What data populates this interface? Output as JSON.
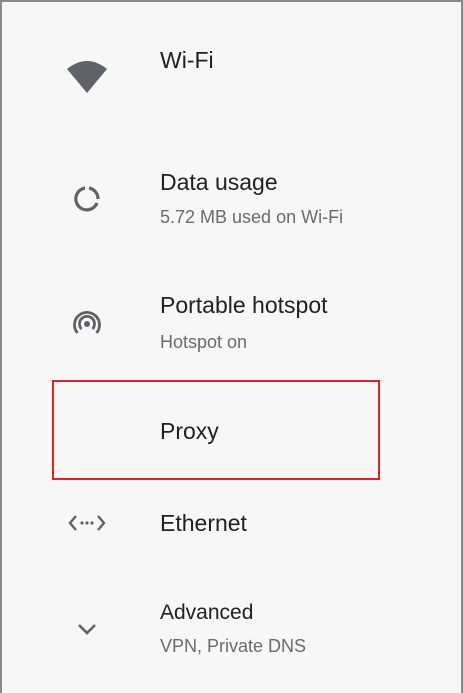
{
  "items": [
    {
      "id": "wifi",
      "title": "Wi-Fi",
      "subtitle": "",
      "icon": "wifi-icon"
    },
    {
      "id": "data-usage",
      "title": "Data usage",
      "subtitle": "5.72 MB used on Wi-Fi",
      "icon": "data-usage-icon"
    },
    {
      "id": "portable-hotspot",
      "title": "Portable hotspot",
      "subtitle": "Hotspot on",
      "icon": "hotspot-icon"
    },
    {
      "id": "proxy",
      "title": "Proxy",
      "subtitle": "",
      "icon": ""
    },
    {
      "id": "ethernet",
      "title": "Ethernet",
      "subtitle": "",
      "icon": "ethernet-icon"
    },
    {
      "id": "advanced",
      "title": "Advanced",
      "subtitle": "VPN, Private DNS",
      "icon": "chevron-down-icon"
    }
  ],
  "colors": {
    "highlight": "#e32020",
    "icon": "#5f6368",
    "title": "#212121",
    "subtitle": "#6b6b6b"
  }
}
